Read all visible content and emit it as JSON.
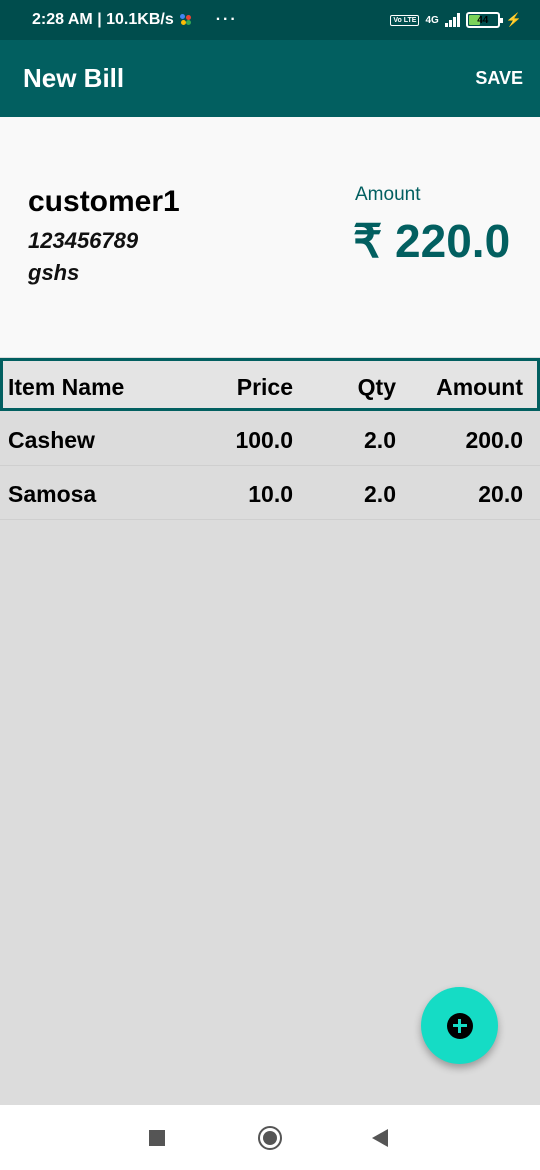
{
  "status_bar": {
    "time_speed": "2:28 AM | 10.1KB/s",
    "more": "···",
    "volte": "Vo LTE",
    "network": "4G",
    "battery": "44",
    "battery_level": 0.44
  },
  "app_bar": {
    "title": "New Bill",
    "save_label": "SAVE"
  },
  "customer": {
    "name": "customer1",
    "phone": "123456789",
    "address": "gshs"
  },
  "total": {
    "label": "Amount",
    "value": "₹ 220.0"
  },
  "table": {
    "headers": {
      "name": "Item Name",
      "price": "Price",
      "qty": "Qty",
      "amount": "Amount"
    },
    "rows": [
      {
        "name": "Cashew",
        "price": "100.0",
        "qty": "2.0",
        "amount": "200.0"
      },
      {
        "name": "Samosa",
        "price": "10.0",
        "qty": "2.0",
        "amount": "20.0"
      }
    ]
  },
  "colors": {
    "primary": "#025f60",
    "status_bar": "#004d4d",
    "fab": "#15dcc5",
    "list_background": "#dcdcdc"
  },
  "icons": {
    "fab": "add-circle-icon",
    "nav_recents": "square-icon",
    "nav_home": "circle-icon",
    "nav_back": "triangle-back-icon"
  }
}
